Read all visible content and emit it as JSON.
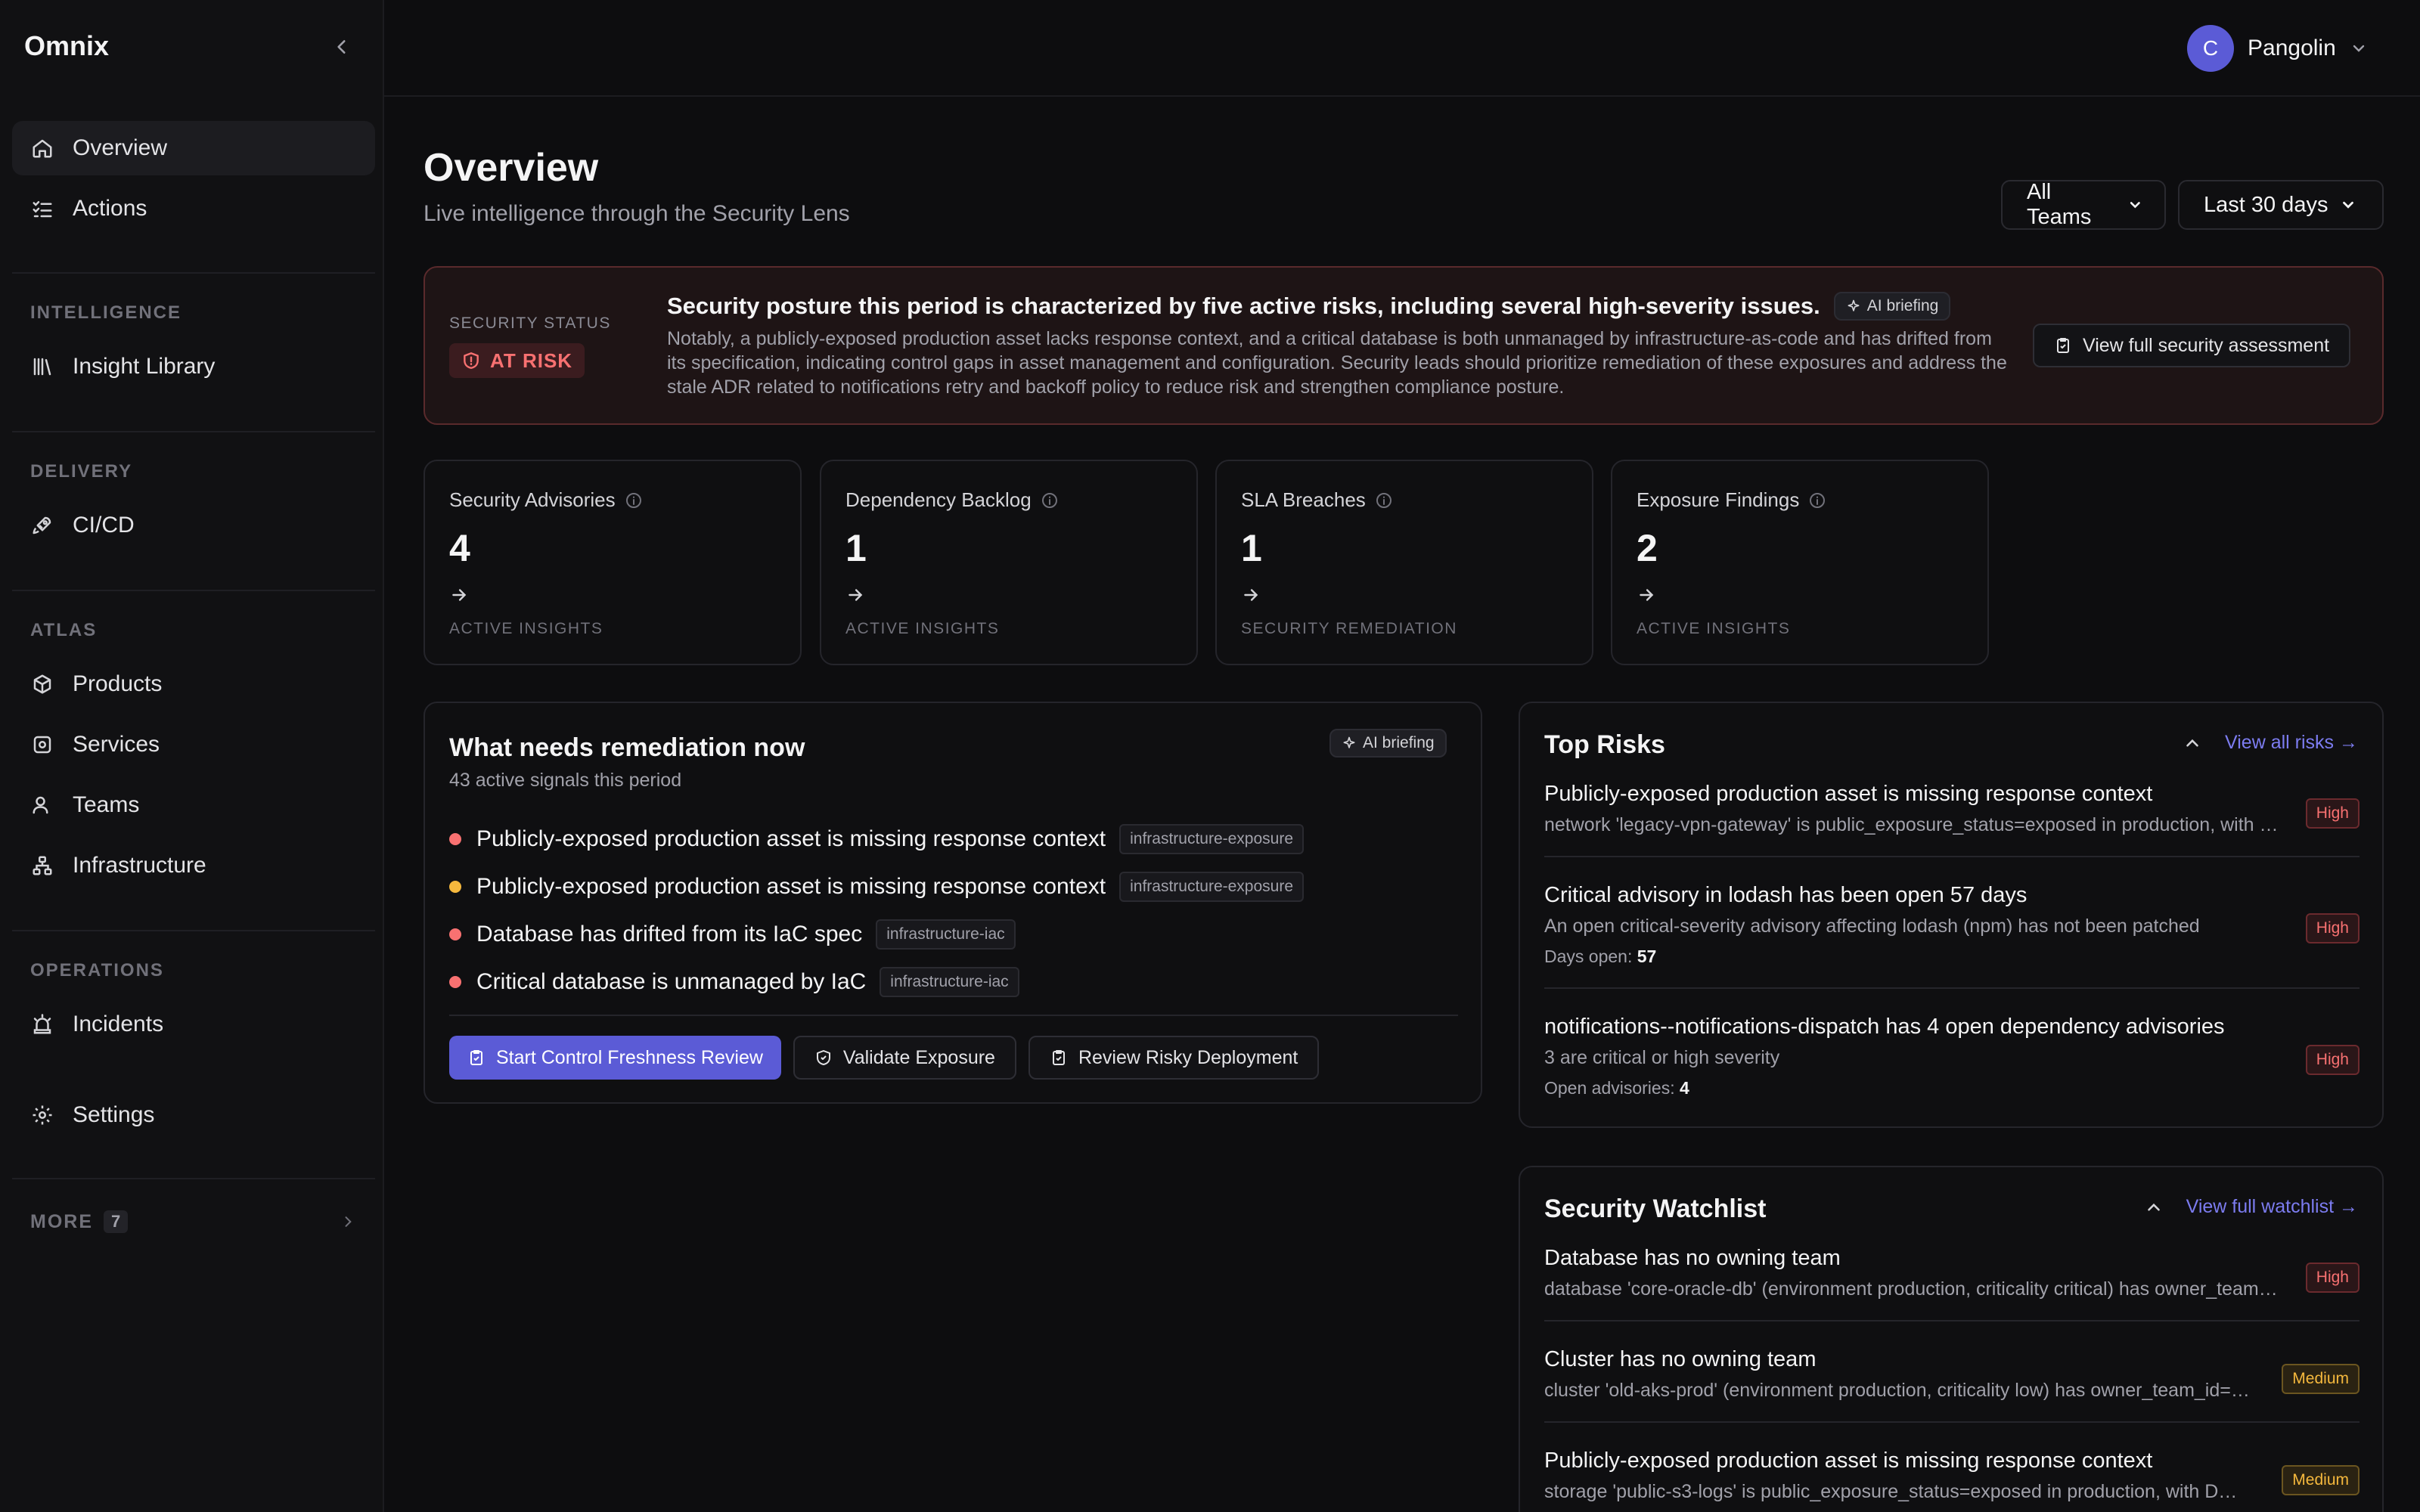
{
  "app": {
    "brand": "Omnix"
  },
  "user": {
    "initial": "C",
    "name": "Pangolin"
  },
  "sidebar": {
    "primary": [
      {
        "label": "Overview",
        "icon": "home-icon"
      },
      {
        "label": "Actions",
        "icon": "list-check-icon"
      }
    ],
    "sections": [
      {
        "title": "INTELLIGENCE",
        "items": [
          {
            "label": "Insight Library",
            "icon": "library-icon"
          }
        ]
      },
      {
        "title": "DELIVERY",
        "items": [
          {
            "label": "CI/CD",
            "icon": "rocket-icon"
          }
        ]
      },
      {
        "title": "ATLAS",
        "items": [
          {
            "label": "Products",
            "icon": "box-icon"
          },
          {
            "label": "Services",
            "icon": "service-icon"
          },
          {
            "label": "Teams",
            "icon": "users-icon"
          },
          {
            "label": "Infrastructure",
            "icon": "network-icon"
          }
        ]
      },
      {
        "title": "OPERATIONS",
        "items": [
          {
            "label": "Incidents",
            "icon": "siren-icon"
          },
          {
            "label": "Settings",
            "icon": "gear-icon"
          }
        ]
      }
    ],
    "more": {
      "label": "MORE",
      "count": "7"
    }
  },
  "header": {
    "title": "Overview",
    "subtitle": "Live intelligence through the Security Lens",
    "team_filter": "All Teams",
    "period_filter": "Last 30 days"
  },
  "status": {
    "label": "SECURITY STATUS",
    "value": "AT RISK",
    "headline": "Security posture this period is characterized by five active risks, including several high-severity issues.",
    "ai_label": "AI briefing",
    "body": "Notably, a publicly-exposed production asset lacks response context, and a critical database is both unmanaged by infrastructure-as-code and has drifted from its specification, indicating control gaps in asset management and configuration. Security leads should prioritize remediation of these exposures and address the stale ADR related to notifications retry and backoff policy to reduce risk and strengthen compliance posture.",
    "action": "View full security assessment",
    "colors": {
      "accent": "#f87171",
      "border": "#5a2a2c"
    }
  },
  "kpis": [
    {
      "title": "Security Advisories",
      "value": "4",
      "footer": "ACTIVE INSIGHTS"
    },
    {
      "title": "Dependency Backlog",
      "value": "1",
      "footer": "ACTIVE INSIGHTS"
    },
    {
      "title": "SLA Breaches",
      "value": "1",
      "footer": "SECURITY REMEDIATION"
    },
    {
      "title": "Exposure Findings",
      "value": "2",
      "footer": "ACTIVE INSIGHTS"
    }
  ],
  "remediation": {
    "title": "What needs remediation now",
    "subtitle": "43 active signals this period",
    "ai_label": "AI briefing",
    "items": [
      {
        "text": "Publicly-exposed production asset is missing response context",
        "tag": "infrastructure-exposure",
        "color": "#f87171"
      },
      {
        "text": "Publicly-exposed production asset is missing response context",
        "tag": "infrastructure-exposure",
        "color": "#f5b83d"
      },
      {
        "text": "Database has drifted from its IaC spec",
        "tag": "infrastructure-iac",
        "color": "#f87171"
      },
      {
        "text": "Critical database is unmanaged by IaC",
        "tag": "infrastructure-iac",
        "color": "#f87171"
      }
    ],
    "actions": {
      "primary": "Start Control Freshness Review",
      "secondary": "Validate Exposure",
      "tertiary": "Review Risky Deployment"
    }
  },
  "top_risks": {
    "title": "Top Risks",
    "link": "View all risks →",
    "items": [
      {
        "title": "Publicly-exposed production asset is missing response context",
        "desc": "network 'legacy-vpn-gateway' is public_exposure_status=exposed in production, with no on-call rotation or runbook",
        "badge": "High"
      },
      {
        "title": "Critical advisory in lodash has been open 57 days",
        "desc": "An open critical-severity advisory affecting lodash (npm) has not been patched",
        "meta_label": "Days open:",
        "meta_value": "57",
        "badge": "High"
      },
      {
        "title": "notifications--notifications-dispatch has 4 open dependency advisories",
        "desc": "3 are critical or high severity",
        "meta_label": "Open advisories:",
        "meta_value": "4",
        "badge": "High"
      }
    ]
  },
  "watchlist": {
    "title": "Security Watchlist",
    "link": "View full watchlist →",
    "items": [
      {
        "title": "Database has no owning team",
        "desc": "database 'core-oracle-db' (environment production, criticality critical) has owner_team_id=null",
        "badge": "High"
      },
      {
        "title": "Cluster has no owning team",
        "desc": "cluster 'old-aks-prod' (environment production, criticality low) has owner_team_id=null",
        "badge": "Medium"
      },
      {
        "title": "Publicly-exposed production asset is missing response context",
        "desc": "storage 'public-s3-logs' is public_exposure_status=exposed in production, with D…",
        "badge": "Medium"
      }
    ]
  }
}
